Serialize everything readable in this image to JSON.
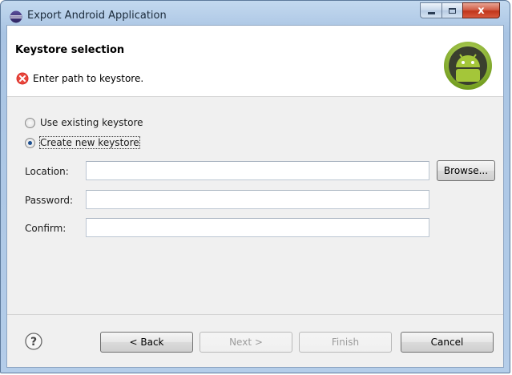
{
  "window": {
    "title": "Export Android Application",
    "controls": {
      "minimize": "minimize",
      "maximize": "maximize",
      "close": "x"
    }
  },
  "header": {
    "title": "Keystore selection",
    "message": "Enter path to keystore.",
    "message_icon": "error-icon",
    "logo": "android-logo"
  },
  "options": [
    {
      "label": "Use existing keystore",
      "selected": false
    },
    {
      "label": "Create new keystore",
      "selected": true
    }
  ],
  "fields": {
    "location": {
      "label": "Location:",
      "value": ""
    },
    "password": {
      "label": "Password:",
      "value": ""
    },
    "confirm": {
      "label": "Confirm:",
      "value": ""
    }
  },
  "browse_label": "Browse...",
  "buttons": {
    "back": "< Back",
    "next": "Next >",
    "finish": "Finish",
    "cancel": "Cancel"
  },
  "colors": {
    "accent": "#1c4f90",
    "error": "#d9302a",
    "android_green": "#a4c639"
  }
}
